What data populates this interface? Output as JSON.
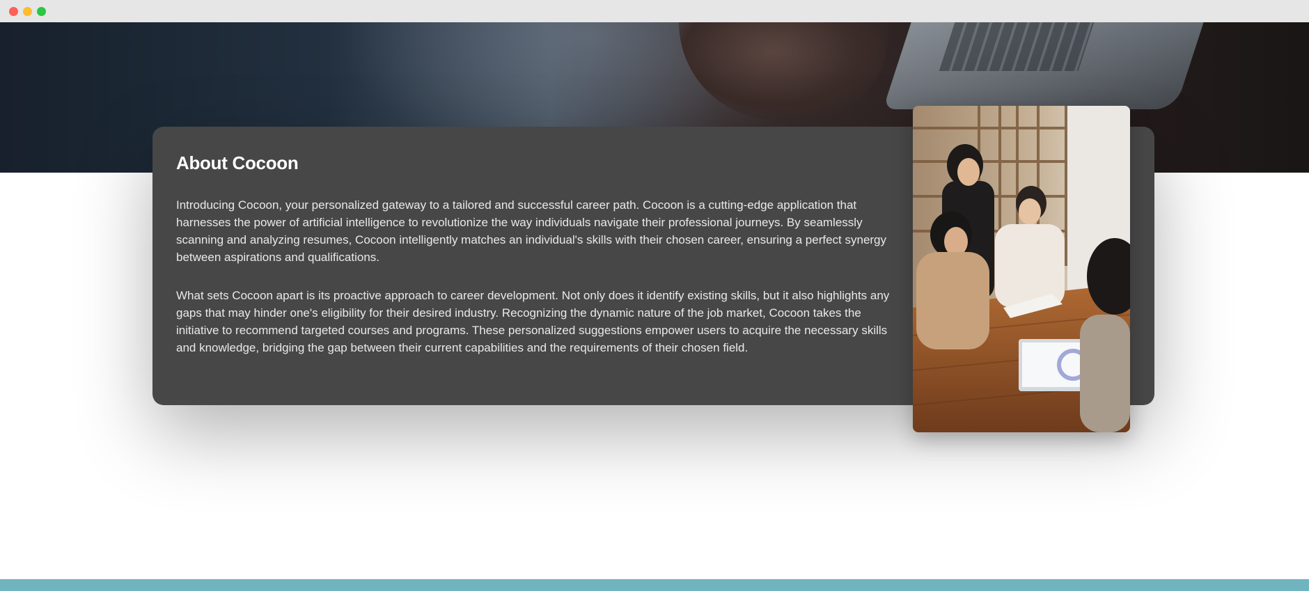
{
  "about": {
    "title": "About Cocoon",
    "paragraphs": [
      "Introducing Cocoon, your personalized gateway to a tailored and successful career path. Cocoon is a cutting-edge application that harnesses the power of artificial intelligence to revolutionize the way individuals navigate their professional journeys. By seamlessly scanning and analyzing resumes, Cocoon intelligently matches an individual's skills with their chosen career, ensuring a perfect synergy between aspirations and qualifications.",
      "What sets Cocoon apart is its proactive approach to career development. Not only does it identify existing skills, but it also highlights any gaps that may hinder one's eligibility for their desired industry. Recognizing the dynamic nature of the job market, Cocoon takes the initiative to recommend targeted courses and programs. These personalized suggestions empower users to acquire the necessary skills and knowledge, bridging the gap between their current capabilities and the requirements of their chosen field."
    ]
  },
  "colors": {
    "card_background": "#474747",
    "footer_accent": "#6fb4bf",
    "window_bar": "#e6e6e6",
    "hero_dark": "#17202c"
  },
  "icons": {
    "close": "window-close-icon",
    "minimize": "window-minimize-icon",
    "maximize": "window-maximize-icon"
  }
}
